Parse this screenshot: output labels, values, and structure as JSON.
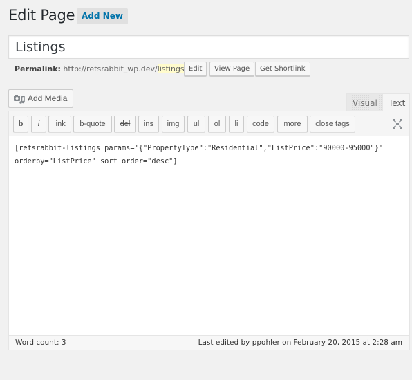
{
  "header": {
    "title": "Edit Page",
    "add_new_label": "Add New"
  },
  "post": {
    "title": "Listings",
    "permalink_label": "Permalink:",
    "permalink_base": "http://retsrabbit_wp.dev/",
    "permalink_slug": "listings",
    "permalink_trailing": "/",
    "edit_label": "Edit",
    "view_page_label": "View Page",
    "get_shortlink_label": "Get Shortlink"
  },
  "media": {
    "add_media_label": "Add Media",
    "icon": "media-icon"
  },
  "editor": {
    "tabs": [
      {
        "label": "Visual",
        "active": false
      },
      {
        "label": "Text",
        "active": true
      }
    ],
    "toolbar": [
      {
        "label": "b",
        "name": "bold"
      },
      {
        "label": "i",
        "name": "italic"
      },
      {
        "label": "link",
        "name": "link"
      },
      {
        "label": "b-quote",
        "name": "b-quote"
      },
      {
        "label": "del",
        "name": "del"
      },
      {
        "label": "ins",
        "name": "ins"
      },
      {
        "label": "img",
        "name": "img"
      },
      {
        "label": "ul",
        "name": "ul"
      },
      {
        "label": "ol",
        "name": "ol"
      },
      {
        "label": "li",
        "name": "li"
      },
      {
        "label": "code",
        "name": "code"
      },
      {
        "label": "more",
        "name": "more"
      },
      {
        "label": "close tags",
        "name": "close-tags"
      }
    ],
    "fullscreen_icon": "fullscreen-icon",
    "content": "[retsrabbit-listings params='{\"PropertyType\":\"Residential\",\"ListPrice\":\"90000-95000\"}'\norderby=\"ListPrice\" sort_order=\"desc\"]"
  },
  "status": {
    "word_count": "Word count: 3",
    "last_edited": "Last edited by ppohler on February 20, 2015 at 2:28 am"
  }
}
